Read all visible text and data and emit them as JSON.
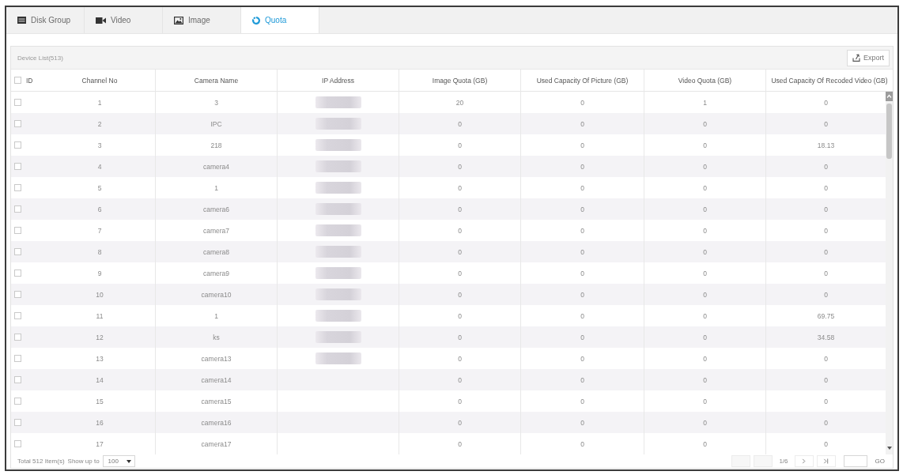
{
  "tabs": [
    {
      "label": "Disk Group",
      "kind": "disk",
      "selected": false
    },
    {
      "label": "Video",
      "kind": "video",
      "selected": false
    },
    {
      "label": "Image",
      "kind": "image",
      "selected": false
    },
    {
      "label": "Quota",
      "kind": "quota",
      "selected": true
    }
  ],
  "panel": {
    "title": "Device List(513)",
    "export_label": "Export"
  },
  "table": {
    "select_all_checked": false,
    "columns": [
      "ID",
      "Channel No",
      "Camera Name",
      "IP Address",
      "Image Quota (GB)",
      "Used Capacity Of Picture (GB)",
      "Video Quota (GB)",
      "Used Capacity Of Recoded Video (GB)"
    ],
    "rows": [
      {
        "checked": false,
        "channel_no": "1",
        "camera_name": "3",
        "ip_blurred": true,
        "image_quota": "20",
        "used_picture": "0",
        "video_quota": "1",
        "used_video": "0"
      },
      {
        "checked": false,
        "channel_no": "2",
        "camera_name": "IPC",
        "ip_blurred": true,
        "image_quota": "0",
        "used_picture": "0",
        "video_quota": "0",
        "used_video": "0"
      },
      {
        "checked": false,
        "channel_no": "3",
        "camera_name": "218",
        "ip_blurred": true,
        "image_quota": "0",
        "used_picture": "0",
        "video_quota": "0",
        "used_video": "18.13"
      },
      {
        "checked": false,
        "channel_no": "4",
        "camera_name": "camera4",
        "ip_blurred": true,
        "image_quota": "0",
        "used_picture": "0",
        "video_quota": "0",
        "used_video": "0"
      },
      {
        "checked": false,
        "channel_no": "5",
        "camera_name": "1",
        "ip_blurred": true,
        "image_quota": "0",
        "used_picture": "0",
        "video_quota": "0",
        "used_video": "0"
      },
      {
        "checked": false,
        "channel_no": "6",
        "camera_name": "camera6",
        "ip_blurred": true,
        "image_quota": "0",
        "used_picture": "0",
        "video_quota": "0",
        "used_video": "0"
      },
      {
        "checked": false,
        "channel_no": "7",
        "camera_name": "camera7",
        "ip_blurred": true,
        "image_quota": "0",
        "used_picture": "0",
        "video_quota": "0",
        "used_video": "0"
      },
      {
        "checked": false,
        "channel_no": "8",
        "camera_name": "camera8",
        "ip_blurred": true,
        "image_quota": "0",
        "used_picture": "0",
        "video_quota": "0",
        "used_video": "0"
      },
      {
        "checked": false,
        "channel_no": "9",
        "camera_name": "camera9",
        "ip_blurred": true,
        "image_quota": "0",
        "used_picture": "0",
        "video_quota": "0",
        "used_video": "0"
      },
      {
        "checked": false,
        "channel_no": "10",
        "camera_name": "camera10",
        "ip_blurred": true,
        "image_quota": "0",
        "used_picture": "0",
        "video_quota": "0",
        "used_video": "0"
      },
      {
        "checked": false,
        "channel_no": "11",
        "camera_name": "1",
        "ip_blurred": true,
        "image_quota": "0",
        "used_picture": "0",
        "video_quota": "0",
        "used_video": "69.75"
      },
      {
        "checked": false,
        "channel_no": "12",
        "camera_name": "ks",
        "ip_blurred": true,
        "image_quota": "0",
        "used_picture": "0",
        "video_quota": "0",
        "used_video": "34.58"
      },
      {
        "checked": false,
        "channel_no": "13",
        "camera_name": "camera13",
        "ip_blurred": true,
        "image_quota": "0",
        "used_picture": "0",
        "video_quota": "0",
        "used_video": "0"
      },
      {
        "checked": false,
        "channel_no": "14",
        "camera_name": "camera14",
        "ip_blurred": false,
        "image_quota": "0",
        "used_picture": "0",
        "video_quota": "0",
        "used_video": "0"
      },
      {
        "checked": false,
        "channel_no": "15",
        "camera_name": "camera15",
        "ip_blurred": false,
        "image_quota": "0",
        "used_picture": "0",
        "video_quota": "0",
        "used_video": "0"
      },
      {
        "checked": false,
        "channel_no": "16",
        "camera_name": "camera16",
        "ip_blurred": false,
        "image_quota": "0",
        "used_picture": "0",
        "video_quota": "0",
        "used_video": "0"
      },
      {
        "checked": false,
        "channel_no": "17",
        "camera_name": "camera17",
        "ip_blurred": false,
        "image_quota": "0",
        "used_picture": "0",
        "video_quota": "0",
        "used_video": "0"
      }
    ]
  },
  "footer": {
    "total": "Total 512 Item(s)",
    "show_up_to_label": "Show up to",
    "page_size": "100",
    "first_disabled": true,
    "previous_disabled": true,
    "page_indicator": "1/6",
    "go_label": "GO"
  }
}
